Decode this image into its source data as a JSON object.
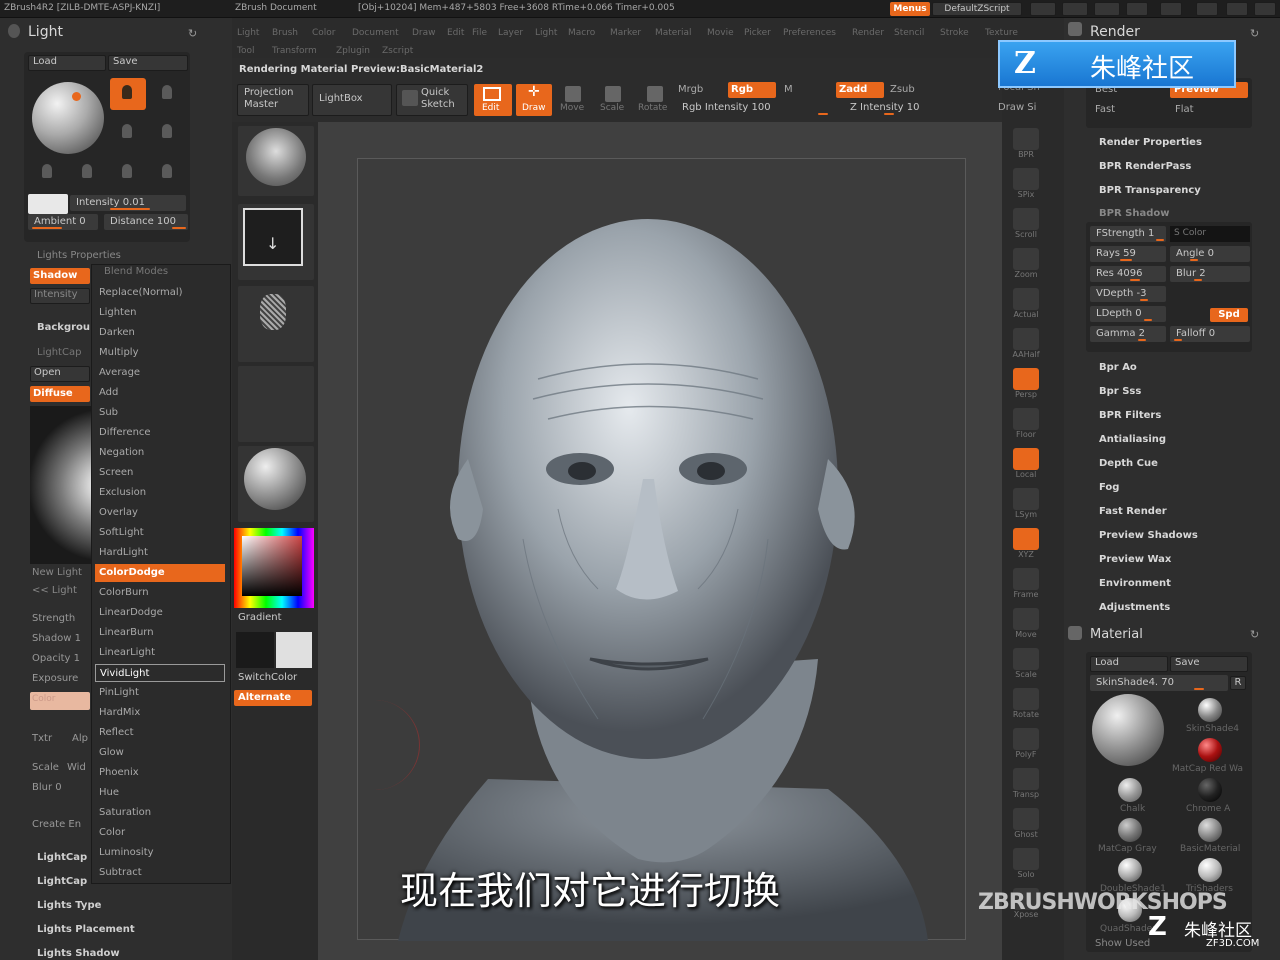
{
  "titlebar": {
    "app": "ZBrush4R2 [ZILB-DMTE-ASPJ-KNZI]",
    "doc": "ZBrush Document",
    "stats": "[Obj+10204] Mem+487+5803 Free+3608 RTime+0.066 Timer+0.005",
    "menus": "Menus",
    "script": "DefaultZScript"
  },
  "menubar": {
    "row1": [
      "Light",
      "Brush",
      "Color",
      "Document",
      "Draw",
      "Edit",
      "File",
      "Layer",
      "Light",
      "Macro",
      "Marker",
      "Material",
      "Movie",
      "Picker",
      "Preferences",
      "Render",
      "Stencil",
      "Stroke",
      "Texture"
    ],
    "row2": [
      "Tool",
      "Transform",
      "Zplugin",
      "Zscript"
    ]
  },
  "light_panel": {
    "title": "Light",
    "load": "Load",
    "save": "Save",
    "intensity": "Intensity 0.01",
    "ambient": "Ambient 0",
    "distance": "Distance 100",
    "lights_properties": "Lights Properties",
    "shadow": "Shadow",
    "intensity_tab": "Intensity",
    "background": "Backgrou",
    "lightcap": "LightCap",
    "open": "Open",
    "diffuse": "Diffuse",
    "new_light": "New Light",
    "prev_light": "<< Light",
    "strength": "Strength",
    "shadow1": "Shadow 1",
    "opacity": "Opacity 1",
    "exposure": "Exposure",
    "color": "Color",
    "txtr": "Txtr",
    "alp": "Alp",
    "scale": "Scale",
    "wid": "Wid",
    "blur": "Blur 0",
    "create_env": "Create En",
    "bottom_items": [
      "LightCap",
      "LightCap",
      "Lights Type",
      "Lights Placement",
      "Lights Shadow"
    ]
  },
  "blend_modes": {
    "header": "Blend Modes",
    "items": [
      "Replace(Normal)",
      "Lighten",
      "Darken",
      "Multiply",
      "Average",
      "Add",
      "Sub",
      "Difference",
      "Negation",
      "Screen",
      "Exclusion",
      "Overlay",
      "SoftLight",
      "HardLight",
      "ColorDodge",
      "ColorBurn",
      "LinearDodge",
      "LinearBurn",
      "LinearLight",
      "VividLight",
      "PinLight",
      "HardMix",
      "Reflect",
      "Glow",
      "Phoenix",
      "Hue",
      "Saturation",
      "Color",
      "Luminosity",
      "Subtract"
    ],
    "selected": "ColorDodge",
    "hovered": "VividLight"
  },
  "toolbar": {
    "rendering_label": "Rendering Material Preview:BasicMaterial2",
    "projection_master": "Projection Master",
    "lightbox": "LightBox",
    "quick_sketch": "Quick Sketch",
    "edit": "Edit",
    "draw": "Draw",
    "move": "Move",
    "scale": "Scale",
    "rotate": "Rotate",
    "mrgb": "Mrgb",
    "rgb": "Rgb",
    "m": "M",
    "rgb_intensity": "Rgb Intensity 100",
    "zadd": "Zadd",
    "zsub": "Zsub",
    "z_intensity": "Z Intensity 10",
    "focal": "Focal Sh",
    "draw_size": "Draw Si"
  },
  "left_shelf": {
    "gradient": "Gradient",
    "switchcolor": "SwitchColor",
    "alternate": "Alternate"
  },
  "right_tools": [
    "BPR",
    "SPix",
    "Scroll",
    "Zoom",
    "Actual",
    "AAHalf",
    "Persp",
    "Floor",
    "Local",
    "LSym",
    "XYZ",
    "Frame",
    "Move",
    "Scale",
    "Rotate",
    "PolyF",
    "Transp",
    "Ghost",
    "Solo",
    "Xpose"
  ],
  "render_panel": {
    "title": "Render",
    "best": "Best",
    "preview": "Preview",
    "fast": "Fast",
    "flat": "Flat",
    "items_top": [
      "Render Properties",
      "BPR RenderPass",
      "BPR Transparency",
      "BPR Shadow"
    ],
    "fstrength": "FStrength 1",
    "scolor": "S Color",
    "rays": "Rays 59",
    "angle": "Angle 0",
    "res": "Res 4096",
    "blur": "Blur 2",
    "vdepth": "VDepth -3",
    "ldepth": "LDepth 0",
    "spd": "Spd",
    "gamma": "Gamma 2",
    "falloff": "Falloff 0",
    "items_bottom": [
      "Bpr Ao",
      "Bpr Sss",
      "BPR Filters",
      "Antialiasing",
      "Depth Cue",
      "Fog",
      "Fast Render",
      "Preview Shadows",
      "Preview Wax",
      "Environment",
      "Adjustments"
    ]
  },
  "material_panel": {
    "title": "Material",
    "load": "Load",
    "save": "Save",
    "skin_shade": "SkinShade4. 70",
    "r": "R",
    "mats": [
      "SkinShade4",
      "MatCap Red Wa",
      "Chalk",
      "Chrome A",
      "MatCap Gray",
      "BasicMaterial",
      "DoubleShade1",
      "TriShaders",
      "QuadShader",
      "Show Used"
    ]
  },
  "overlay": {
    "subtitle": "现在我们对它进行切换",
    "brand_watermark": "ZBRUSHWORKSHOPS",
    "logo_text": "朱峰社区",
    "corner_logo": "朱峰社区",
    "corner_url": "ZF3D.COM"
  },
  "colors": {
    "accent": "#e8671c",
    "panel": "#2e2e2e",
    "bg": "#2a2a2a"
  }
}
